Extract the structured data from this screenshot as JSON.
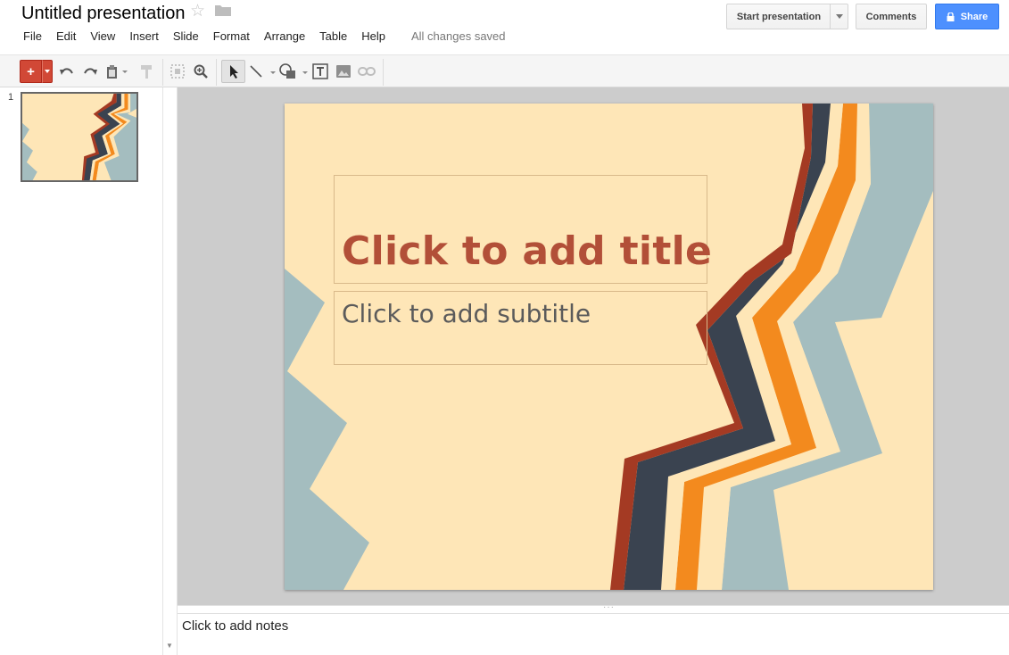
{
  "header": {
    "title": "Untitled presentation",
    "menu": [
      "File",
      "Edit",
      "View",
      "Insert",
      "Slide",
      "Format",
      "Arrange",
      "Table",
      "Help"
    ],
    "save_status": "All changes saved",
    "start_presentation_label": "Start presentation",
    "comments_label": "Comments",
    "share_label": "Share"
  },
  "toolbar": {
    "icons": [
      "new-slide",
      "undo",
      "redo",
      "paste",
      "paint-format",
      "zoom-fit",
      "zoom",
      "select",
      "line",
      "shape",
      "text-box",
      "image",
      "link"
    ]
  },
  "filmstrip": {
    "slide_number": "1"
  },
  "slide": {
    "title_placeholder": "Click to add title",
    "subtitle_placeholder": "Click to add subtitle"
  },
  "notes": {
    "placeholder": "Click to add notes"
  },
  "colors": {
    "slide_background": "#fee6b7",
    "title_color": "#b24f38",
    "stripe_red": "#a43a23",
    "stripe_navy": "#3a4350",
    "stripe_orange": "#f38a1e",
    "stripe_blue_gray": "#a4bdbf",
    "share_blue": "#4d90fe",
    "new_slide_red": "#d14836"
  }
}
